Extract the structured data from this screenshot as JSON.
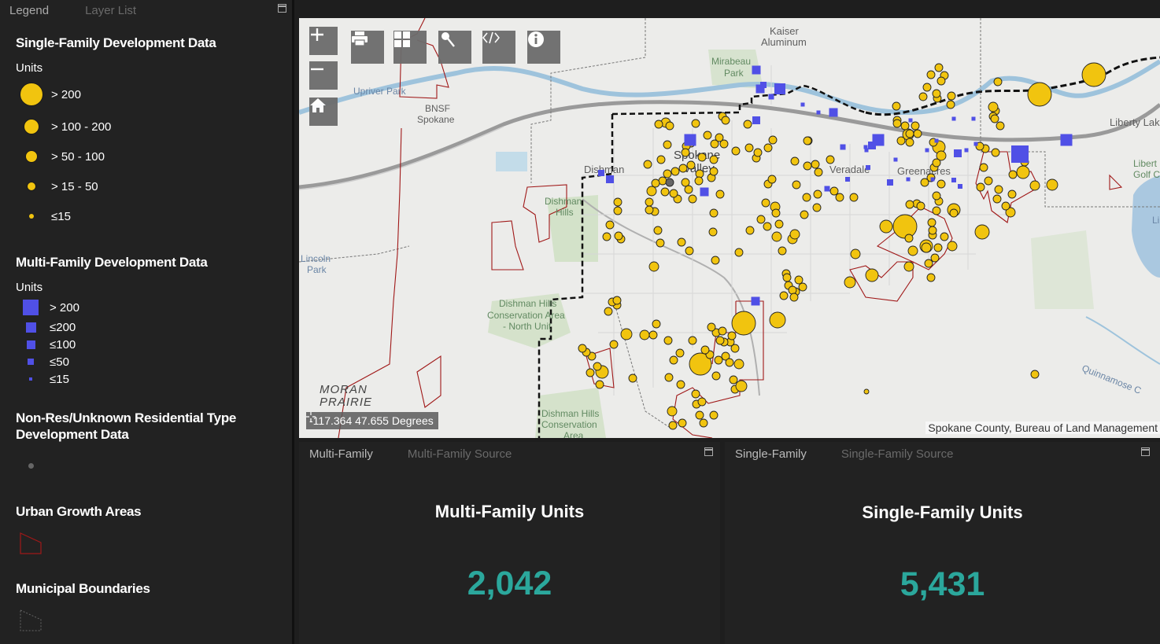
{
  "legend_panel": {
    "tabs": [
      {
        "label": "Legend"
      },
      {
        "label": "Layer List"
      }
    ],
    "single_family": {
      "title": "Single-Family Development Data",
      "units_label": "Units",
      "classes": [
        {
          "label": "> 200",
          "color": "#f1c40f"
        },
        {
          "label": "> 100 - 200",
          "color": "#f1c40f"
        },
        {
          "label": "> 50 - 100",
          "color": "#f1c40f"
        },
        {
          "label": "> 15 - 50",
          "color": "#f1c40f"
        },
        {
          "label": "≤15",
          "color": "#f1c40f"
        }
      ]
    },
    "multi_family": {
      "title": "Multi-Family Development Data",
      "units_label": "Units",
      "classes": [
        {
          "label": "> 200",
          "color": "#5050e6"
        },
        {
          "label": "≤200",
          "color": "#5050e6"
        },
        {
          "label": "≤100",
          "color": "#5050e6"
        },
        {
          "label": "≤50",
          "color": "#5050e6"
        },
        {
          "label": "≤15",
          "color": "#5050e6"
        }
      ]
    },
    "non_res": {
      "title_line1": "Non-Res/Unknown Residential Type",
      "title_line2": "Development Data",
      "color": "#666666"
    },
    "urban_growth": {
      "title": "Urban Growth Areas",
      "color": "#a01818"
    },
    "municipal": {
      "title": "Municipal Boundaries",
      "color": "#555555"
    }
  },
  "map": {
    "tools": [
      {
        "name": "zoom-in",
        "icon": "plus-icon"
      },
      {
        "name": "zoom-out",
        "icon": "minus-icon"
      },
      {
        "name": "home",
        "icon": "home-icon"
      },
      {
        "name": "print",
        "icon": "print-icon"
      },
      {
        "name": "basemap-gallery",
        "icon": "grid-icon"
      },
      {
        "name": "measure",
        "icon": "pin-icon"
      },
      {
        "name": "share",
        "icon": "code-icon"
      },
      {
        "name": "about",
        "icon": "info-icon"
      }
    ],
    "labels": {
      "kaiser": "Kaiser",
      "aluminum": "Aluminum",
      "mirabeau": "Mirabeau",
      "park": "Park",
      "upriver_park": "Upriver Park",
      "bnsf": "BNSF",
      "spokane_rail": "Spokane",
      "spokane": "Spokane",
      "valley": "Valley",
      "dishman": "Dishman",
      "veradale": "Veradale",
      "greenacres": "Greenacres",
      "liberty_lake": "Liberty Lak",
      "liberty_golf": "Libert",
      "golf": "Golf C",
      "dishman_hills_1": "Dishman",
      "dishman_hills_2": "Hills",
      "lincoln": "Lincoln",
      "lincoln_park": "Park",
      "conservation_1": "Dishman Hills",
      "conservation_2": "Conservation Area",
      "conservation_3": "- North Unit",
      "conservation_b1": "Dishman Hills",
      "conservation_b2": "Conservation",
      "conservation_b3": "Area",
      "moran": "MORAN",
      "prairie": "PRAIRIE",
      "quinnamose": "Quinnamose C",
      "li": "Li"
    },
    "coordinates": "-117.364 47.655 Degrees",
    "attribution": "Spokane County, Bureau of Land Management"
  },
  "multi_family_panel": {
    "tabs": [
      {
        "label": "Multi-Family"
      },
      {
        "label": "Multi-Family Source"
      }
    ],
    "title": "Multi-Family Units",
    "value": "2,042"
  },
  "single_family_panel": {
    "tabs": [
      {
        "label": "Single-Family"
      },
      {
        "label": "Single-Family Source"
      }
    ],
    "title": "Single-Family Units",
    "value": "5,431"
  }
}
